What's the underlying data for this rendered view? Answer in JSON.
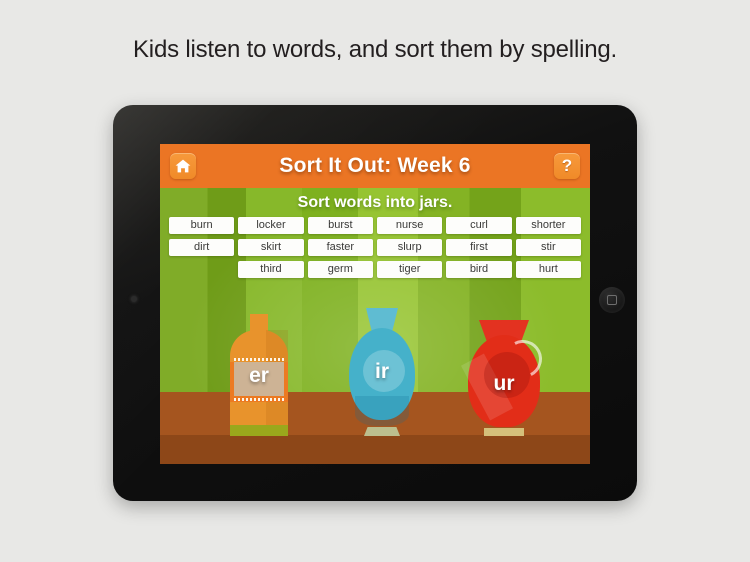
{
  "caption": "Kids listen to words, and sort them by spelling.",
  "app": {
    "header": {
      "title": "Sort It Out: Week 6",
      "home_icon": "home-icon",
      "help_label": "?"
    },
    "instruction": "Sort words into jars.",
    "words": [
      [
        "burn",
        "locker",
        "burst",
        "nurse",
        "curl",
        "shorter"
      ],
      [
        "dirt",
        "skirt",
        "faster",
        "slurp",
        "first",
        "stir"
      ],
      [
        "",
        "third",
        "germ",
        "tiger",
        "bird",
        "hurt"
      ]
    ],
    "jars": [
      {
        "label": "er",
        "color": "#e8932c"
      },
      {
        "label": "ir",
        "color": "#45b1ca"
      },
      {
        "label": "ur",
        "color": "#e22d18"
      }
    ],
    "colors": {
      "header_bg": "#eb7524",
      "button_bg": "#f08a28",
      "play_bg": "#84b324",
      "shelf": "#a5551f",
      "shelf_shadow": "#8d4718",
      "tile_bg": "#fdfdfb",
      "tile_text": "#3a3a38"
    }
  },
  "device": {
    "camera_icon": "camera-icon",
    "home_button_icon": "home-button-icon"
  }
}
